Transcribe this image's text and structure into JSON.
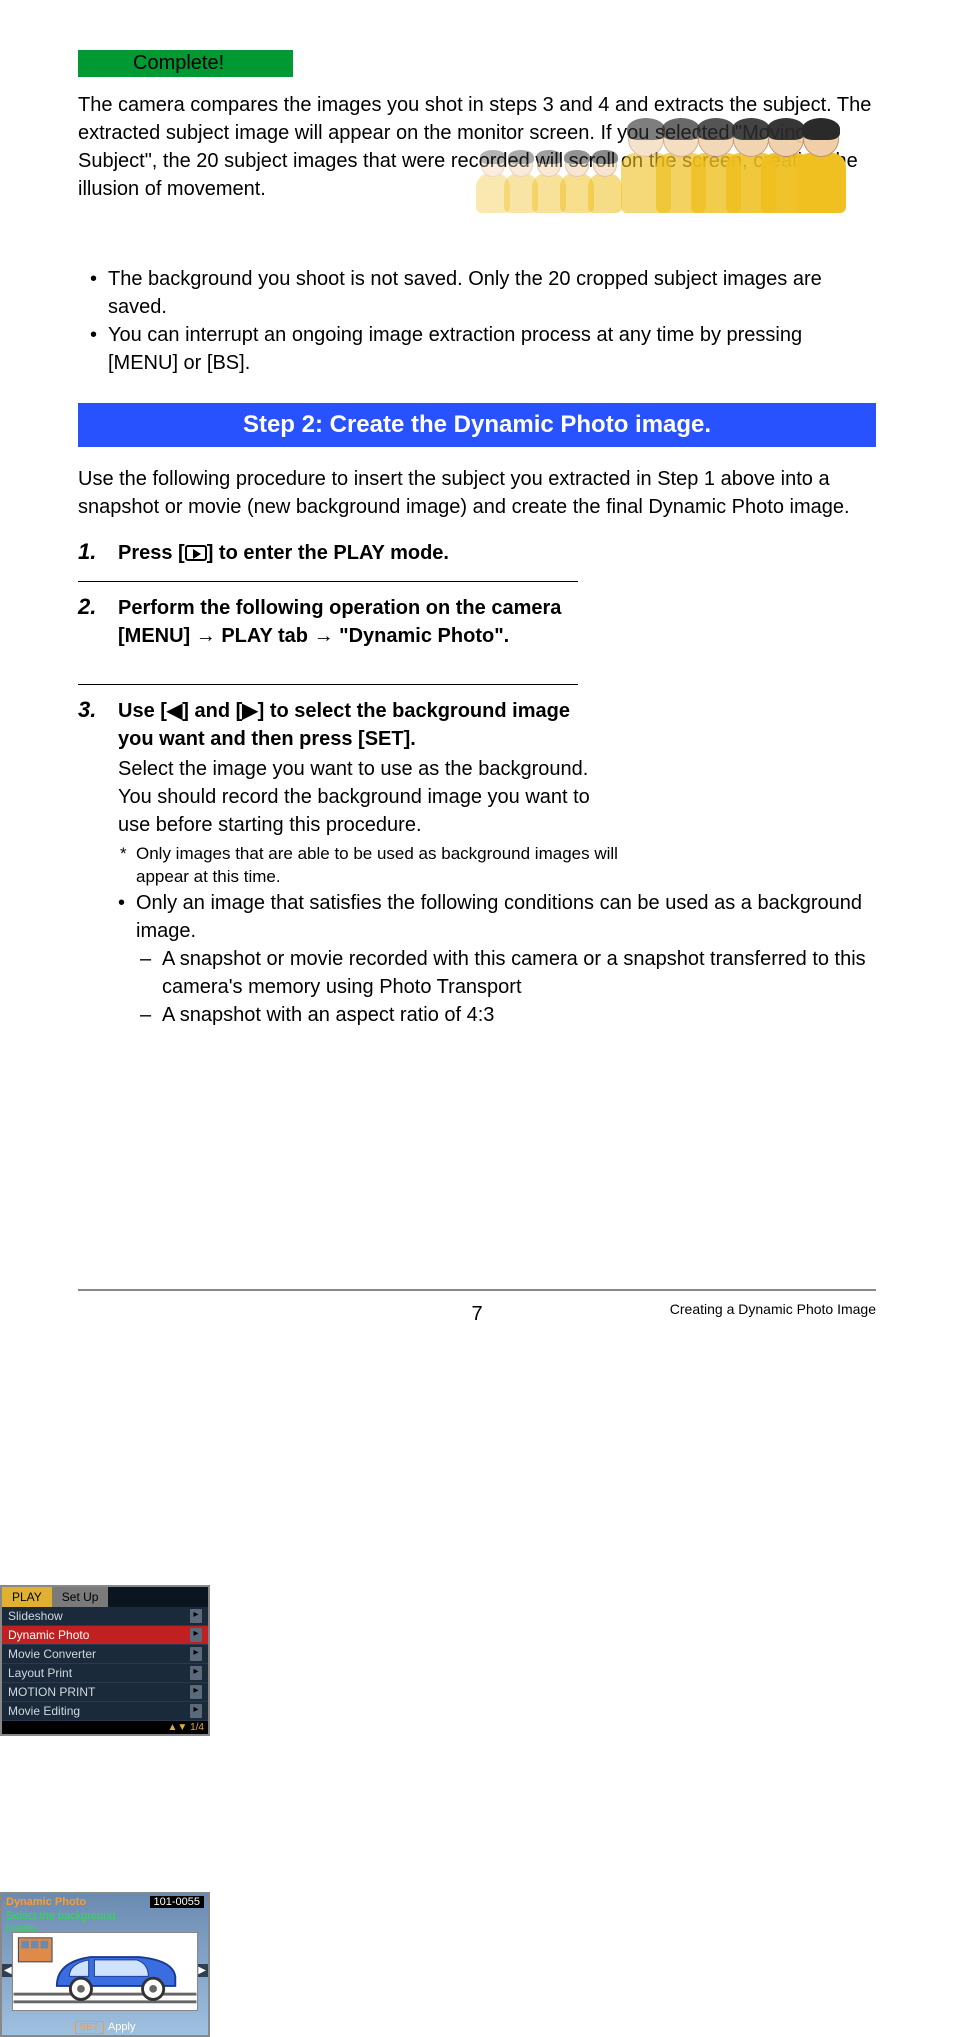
{
  "complete_label": "Complete!",
  "intro_paragraph": "The camera compares the images you shot in steps 3 and 4 and extracts the subject. The extracted subject image will appear on the monitor screen. If you selected \"Moving Subject\", the 20 subject images that were recorded will scroll on the screen, creating the illusion of movement.",
  "intro_bullets": [
    "The background you shoot is not saved. Only the 20 cropped subject images are saved.",
    "You can interrupt an ongoing image extraction process at any time by pressing [MENU] or [BS]."
  ],
  "step2_banner": "Step 2: Create the Dynamic Photo image.",
  "step2_intro": "Use the following procedure to insert the subject you extracted in Step 1 above into a snapshot or movie (new background image) and create the final Dynamic Photo image.",
  "steps": {
    "s1": {
      "num": "1.",
      "title_before": "Press [",
      "title_after": "] to enter the PLAY mode."
    },
    "s2": {
      "num": "2.",
      "title": "Perform the following operation on the camera",
      "line2_before": "[MENU] ",
      "line2_mid1": " PLAY tab ",
      "line2_after": " \"Dynamic Photo\"."
    },
    "s3": {
      "num": "3.",
      "title": "Use [◀] and [▶] to select the background image you want and then press [SET].",
      "text": "Select the image you want to use as the background. You should record the background image you want to use before starting this procedure.",
      "star_note": "Only images that are able to be used as background images will appear at this time.",
      "sub_bullet": "Only an image that satisfies the following conditions can be used as a background image.",
      "dashes": [
        "A snapshot or movie recorded with this camera or a snapshot transferred to this camera's memory using Photo Transport",
        "A snapshot with an aspect ratio of 4:3"
      ]
    }
  },
  "cam_menu": {
    "tabs": {
      "play": "PLAY",
      "setup": "Set Up"
    },
    "items": [
      {
        "label": "Slideshow"
      },
      {
        "label": "Dynamic Photo",
        "highlight": true
      },
      {
        "label": "Movie Converter"
      },
      {
        "label": "Layout Print"
      },
      {
        "label": "MOTION PRINT"
      },
      {
        "label": "Movie Editing"
      }
    ],
    "footer": "▲▼ 1/4"
  },
  "car_screen": {
    "title": "Dynamic Photo",
    "file": "101-0055",
    "msg1": "Select the background",
    "msg2": "image.",
    "set": "SET",
    "apply": "Apply"
  },
  "footer": {
    "page_number": "7",
    "title": "Creating a Dynamic Photo Image"
  }
}
